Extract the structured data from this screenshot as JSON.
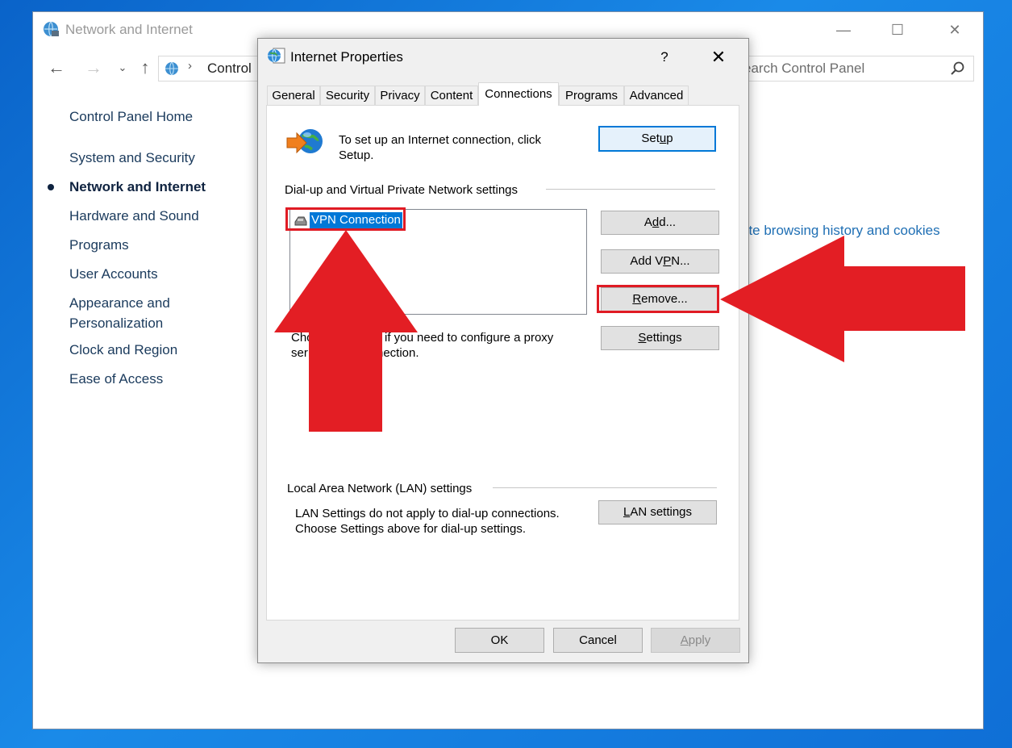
{
  "background_window": {
    "title": "Network and Internet",
    "controls": {
      "minimize": "—",
      "maximize": "☐",
      "close": "✕"
    },
    "address": {
      "crumb_separator": "›",
      "text": "Control"
    },
    "search": {
      "placeholder": "earch Control Panel"
    },
    "sidebar": {
      "items": [
        {
          "label": "Control Panel Home"
        },
        {
          "label": "System and Security"
        },
        {
          "label": "Network and Internet",
          "active": true
        },
        {
          "label": "Hardware and Sound"
        },
        {
          "label": "Programs"
        },
        {
          "label": "User Accounts"
        },
        {
          "label": "Appearance and"
        },
        {
          "label": "Personalization"
        },
        {
          "label": "Clock and Region"
        },
        {
          "label": "Ease of Access"
        }
      ]
    },
    "link": "ete browsing history and cookies"
  },
  "dialog": {
    "title": "Internet Properties",
    "help": "?",
    "close": "✕",
    "tabs": [
      "General",
      "Security",
      "Privacy",
      "Content",
      "Connections",
      "Programs",
      "Advanced"
    ],
    "selected_tab": "Connections",
    "setup_text_1": "To set up an Internet connection, click",
    "setup_text_2": "Setup.",
    "setup_button": {
      "pre": "Set",
      "u": "u",
      "post": "p"
    },
    "dialup_heading": "Dial-up and Virtual Private Network settings",
    "connections": [
      {
        "label": "VPN Connection",
        "selected": true
      }
    ],
    "add_button": {
      "pre": "A",
      "u": "d",
      "post": "d..."
    },
    "add_vpn_button": {
      "pre": "Add V",
      "u": "P",
      "post": "N..."
    },
    "remove_button": {
      "pre": "",
      "u": "R",
      "post": "emove..."
    },
    "settings_button": {
      "pre": "",
      "u": "S",
      "post": "ettings"
    },
    "proxy_text_1a": "Cho",
    "proxy_text_1b": "if you need to configure a proxy",
    "proxy_text_2a": "ser",
    "proxy_text_2b": "nection.",
    "lan_heading": "Local Area Network (LAN) settings",
    "lan_text_1": "LAN Settings do not apply to dial-up connections.",
    "lan_text_2": "Choose Settings above for dial-up settings.",
    "lan_button": {
      "pre": "",
      "u": "L",
      "post": "AN settings"
    },
    "ok": "OK",
    "cancel": "Cancel",
    "apply": {
      "pre": "",
      "u": "A",
      "post": "pply"
    }
  },
  "annotations": {
    "color": "#e01b24"
  },
  "colors": {
    "accent": "#0078d7",
    "link": "#1f6fb4",
    "desktop": "#1a8ae8"
  }
}
